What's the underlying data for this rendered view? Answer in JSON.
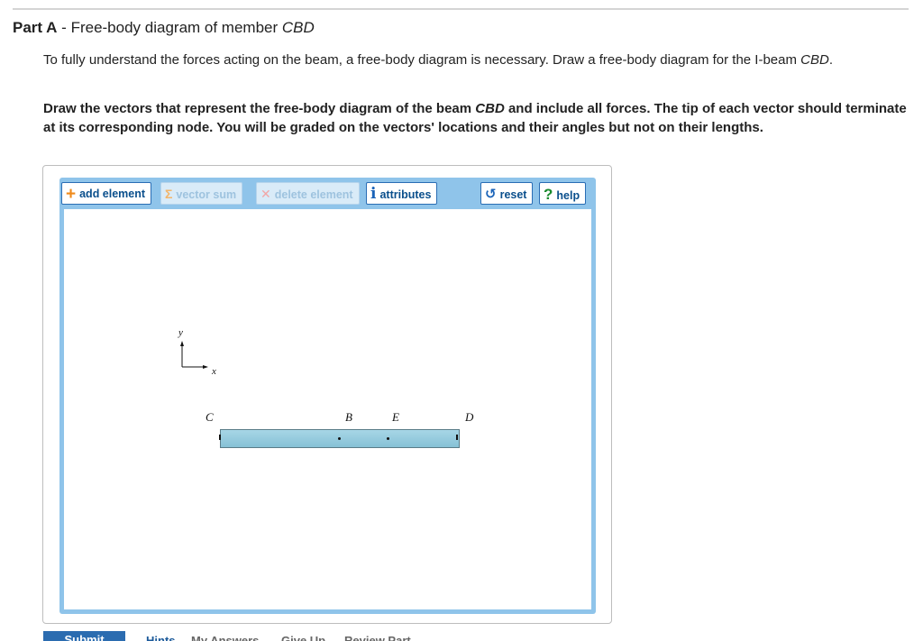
{
  "part": {
    "label": "Part A",
    "separator": " - ",
    "title_text": "Free-body diagram of member ",
    "title_em": "CBD"
  },
  "intro": {
    "text": "To fully understand the forces acting on the beam, a free-body diagram is necessary. Draw a free-body diagram for the I-beam ",
    "em": "CBD",
    "end": "."
  },
  "instructions": {
    "text1": "Draw the vectors that represent the free-body diagram of the beam ",
    "em": "CBD",
    "text2": " and include all forces. The tip of each vector should terminate at its corresponding node. You will be graded on the vectors' locations and their angles but not on their lengths."
  },
  "toolbar": {
    "add_element": "add element",
    "vector_sum": "vector sum",
    "delete_element": "delete element",
    "attributes": "attributes",
    "reset": "reset",
    "help": "help"
  },
  "icons": {
    "add": "+",
    "sum": "Σ",
    "delete": "✕",
    "info": "i",
    "reset": "↺",
    "help": "?"
  },
  "diagram": {
    "axis_y": "y",
    "axis_x": "x",
    "nodes": {
      "C": "C",
      "B": "B",
      "E": "E",
      "D": "D"
    }
  },
  "bottom": {
    "submit": "Submit",
    "hints": "Hints",
    "my_answers": "My Answers",
    "give_up": "Give Up",
    "review_part": "Review Part"
  },
  "colors": {
    "toolbar_bg": "#8fc4ea",
    "beam_fill": "#9acfe2",
    "submit_bg": "#2b6cb0"
  }
}
